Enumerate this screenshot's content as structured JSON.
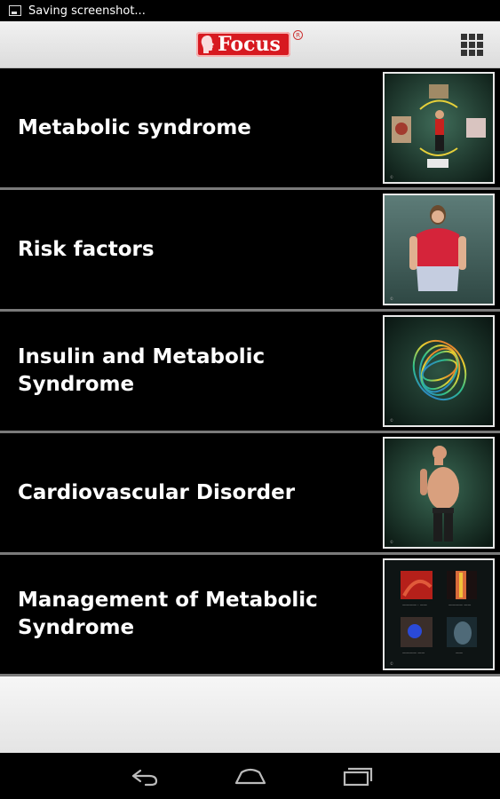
{
  "status_bar": {
    "notification_text": "Saving screenshot..."
  },
  "app_bar": {
    "logo_text": "Focus",
    "logo_registered": "R",
    "menu_icon": "grid-icon"
  },
  "topics": [
    {
      "title": "Metabolic syndrome",
      "thumbnail": "metabolic-syndrome-thumbnail"
    },
    {
      "title": "Risk factors",
      "thumbnail": "risk-factors-thumbnail"
    },
    {
      "title": "Insulin and Metabolic Syndrome",
      "thumbnail": "insulin-thumbnail"
    },
    {
      "title": "Cardiovascular Disorder",
      "thumbnail": "cardiovascular-thumbnail"
    },
    {
      "title": "Management of Metabolic Syndrome",
      "thumbnail": "management-thumbnail"
    }
  ],
  "nav_bar": {
    "back_icon": "back-icon",
    "home_icon": "home-icon",
    "recents_icon": "recents-icon"
  }
}
